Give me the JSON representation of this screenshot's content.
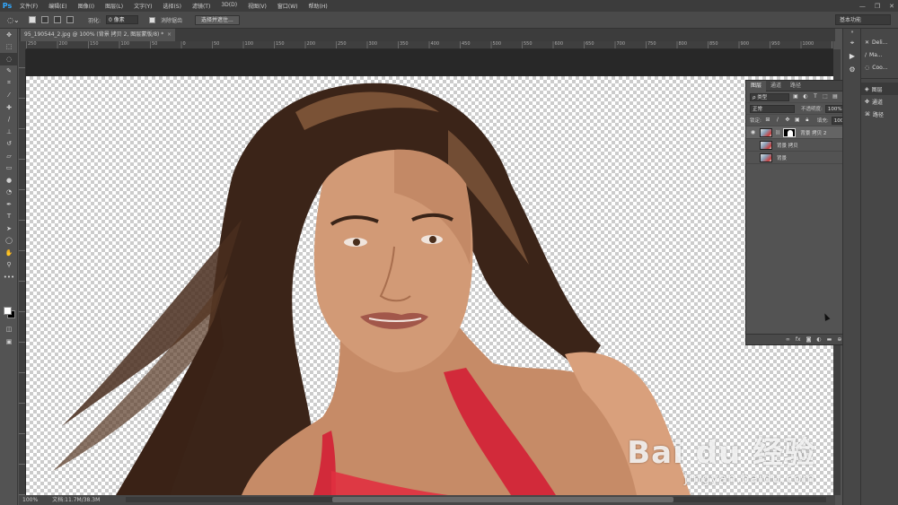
{
  "app": {
    "logo": "Ps"
  },
  "menu": [
    "文件(F)",
    "编辑(E)",
    "图像(I)",
    "图层(L)",
    "文字(Y)",
    "选择(S)",
    "滤镜(T)",
    "3D(D)",
    "视图(V)",
    "窗口(W)",
    "帮助(H)"
  ],
  "window_controls": {
    "minimize": "—",
    "restore": "❐",
    "close": "✕"
  },
  "options": {
    "feather_label": "羽化:",
    "feather_value": "0 像素",
    "antialias_label": "消除锯齿",
    "select_mask_button": "选择并遮住...",
    "workspace": "基本功能"
  },
  "document": {
    "tab_title": "95_190544_2.jpg @ 100% (背景 拷贝 2, 图层蒙版/8) *",
    "close": "×"
  },
  "ruler_h": [
    "250",
    "200",
    "150",
    "100",
    "50",
    "0",
    "50",
    "100",
    "150",
    "200",
    "250",
    "300",
    "350",
    "400",
    "450",
    "500",
    "550",
    "600",
    "650",
    "700",
    "750",
    "800",
    "850",
    "900",
    "950",
    "1000",
    "1050",
    "1100",
    "1150",
    "1200",
    "1250",
    "1300",
    "1350",
    "1400",
    "1450",
    "1500",
    "1550",
    "1600",
    "1650",
    "1700",
    "1750",
    "1800",
    "1850",
    "1900",
    "1950"
  ],
  "status": {
    "zoom": "100%",
    "doc": "文档:11.7M/38.3M"
  },
  "dock": {
    "items": [
      {
        "label": "Deli..."
      },
      {
        "label": "Ma..."
      },
      {
        "label": "Coo..."
      }
    ],
    "panels": [
      {
        "label": "图层"
      },
      {
        "label": "通道"
      },
      {
        "label": "路径"
      }
    ]
  },
  "layers_panel": {
    "tabs": [
      "图层",
      "通道",
      "路径"
    ],
    "menu": "»  ≡",
    "filter_kind": "ρ 类型",
    "blend_mode": "正常",
    "opacity_label": "不透明度:",
    "opacity_value": "100%",
    "lock_label": "锁定:",
    "fill_label": "填充:",
    "fill_value": "100%",
    "layers": [
      {
        "name": "背景 拷贝 2",
        "visible": true,
        "selected": true,
        "has_mask": true,
        "locked": false
      },
      {
        "name": "背景 拷贝",
        "visible": false,
        "selected": false,
        "has_mask": false,
        "locked": false
      },
      {
        "name": "背景",
        "visible": false,
        "selected": false,
        "has_mask": false,
        "locked": true
      }
    ],
    "footer_icons": [
      "link-icon",
      "fx-icon",
      "mask-icon",
      "adjustment-icon",
      "folder-icon",
      "new-layer-icon",
      "trash-icon"
    ]
  },
  "watermark": {
    "main": "Bai du 经验",
    "sub": "jingyan.baidu.com"
  }
}
